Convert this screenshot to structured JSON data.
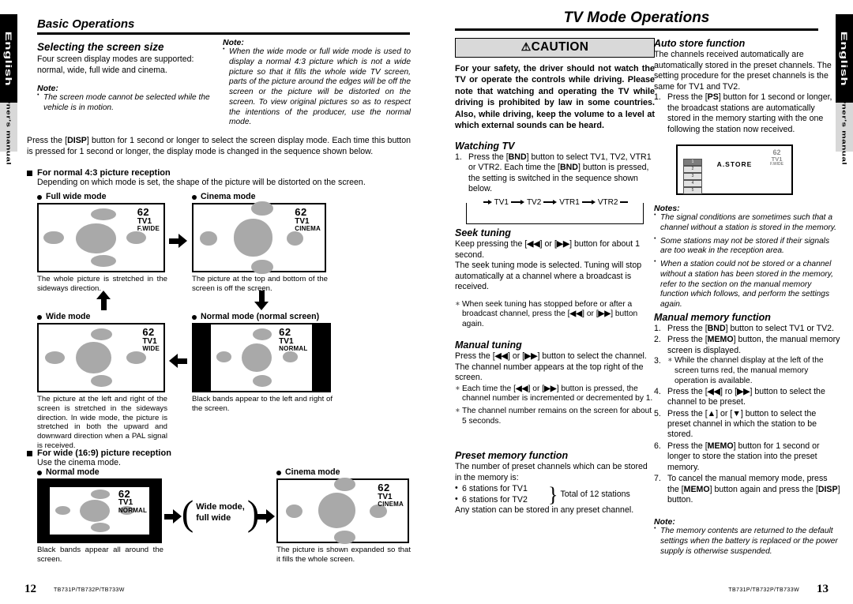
{
  "sidetabs": {
    "language": "English",
    "manual": "Owner's manual"
  },
  "left_page": {
    "chapter_title": "Basic Operations",
    "page_number": "12",
    "model_footer": "TB731P/TB732P/TB733W",
    "section_screen_size": {
      "title": "Selecting the screen size",
      "body": "Four screen display modes are supported: normal, wide, full wide and cinema.",
      "note_label": "Note:",
      "note_items": [
        "The screen mode cannot be selected while the vehicle is in motion."
      ]
    },
    "note_right": {
      "label": "Note:",
      "items": [
        "When the wide mode or full wide mode is used to display a normal 4:3 picture which is not a wide picture so that it fills the whole wide TV screen, parts of the picture around the edges will be off the screen or the picture will be distorted on the screen.  To view original pictures so as to respect the intentions of the producer, use the normal mode."
      ]
    },
    "disp_paragraph": "Press the [DISP] button for 1 second or longer to select the screen display mode. Each time this button is pressed for 1 second or longer, the display mode is changed in the sequence shown below.",
    "disp_button": "DISP",
    "normal43": {
      "heading": "For normal 4:3 picture reception",
      "subtext": "Depending on which mode is set, the shape of the picture will be distorted on the screen."
    },
    "wide169": {
      "heading": "For wide (16:9) picture reception",
      "subtext": "Use the cinema mode."
    },
    "modes": {
      "fullwide": {
        "label": "Full wide mode",
        "osd_channel": "62",
        "osd_band": "TV1",
        "osd_mode": "F.WIDE",
        "caption": "The whole picture is stretched in the sideways direction."
      },
      "cinema": {
        "label": "Cinema mode",
        "osd_channel": "62",
        "osd_band": "TV1",
        "osd_mode": "CINEMA",
        "caption": "The picture at the top and bottom of the screen is off the screen."
      },
      "wide": {
        "label": "Wide mode",
        "osd_channel": "62",
        "osd_band": "TV1",
        "osd_mode": "WIDE",
        "caption": "The picture at the left and right of the screen is stretched in the sideways direction. In wide mode, the picture is stretched in both the upward and downward direction when a PAL signal is received."
      },
      "normal": {
        "label": "Normal mode (normal screen)",
        "osd_channel": "62",
        "osd_band": "TV1",
        "osd_mode": "NORMAL",
        "caption": "Black bands appear to the left and right of the screen."
      },
      "normal169": {
        "label": "Normal mode",
        "osd_channel": "62",
        "osd_band": "TV1",
        "osd_mode": "NORMAL",
        "caption": "Black bands appear all around the screen."
      },
      "cinema169": {
        "label": "Cinema mode",
        "osd_channel": "62",
        "osd_band": "TV1",
        "osd_mode": "CINEMA",
        "caption": "The picture is shown expanded so that it fills the whole screen."
      }
    },
    "transition_label": "Wide mode,\nfull wide"
  },
  "right_page": {
    "chapter_title": "TV Mode Operations",
    "page_number": "13",
    "model_footer": "TB731P/TB732P/TB733W",
    "caution": {
      "title": "CAUTION",
      "symbol": "⚠",
      "body": "For your safety, the driver should not watch the TV or operate the controls while driving. Please note that watching and operating the TV while driving is prohibited by law in some countries. Also, while driving, keep the volume to a level at which external sounds can be heard."
    },
    "watching_tv": {
      "title": "Watching TV",
      "steps": [
        "Press the [BND] button to select TV1, TV2, VTR1 or VTR2. Each time the [BND] button is pressed, the setting is switched in the sequence shown below."
      ],
      "sequence": [
        "TV1",
        "TV2",
        "VTR1",
        "VTR2"
      ]
    },
    "seek_tuning": {
      "title": "Seek tuning",
      "body": "Keep pressing the [◀◀] or [▶▶] button for about 1 second.\nThe seek tuning mode is selected.  Tuning will stop automatically at a channel where a broadcast is received.",
      "notes": [
        "When seek tuning has stopped before or after a broadcast channel, press the [◀◀] or [▶▶] button again."
      ]
    },
    "manual_tuning": {
      "title": "Manual tuning",
      "body": "Press the [◀◀] or [▶▶] button to select the channel.\nThe channel number appears at the top right of the screen.",
      "notes": [
        "Each time the [◀◀] or [▶▶] button is pressed, the channel number is incremented or decremented by 1.",
        "The channel number remains on the screen for about 5 seconds."
      ]
    },
    "preset_memory": {
      "title": "Preset memory function",
      "body": "The number of preset channels which can be stored in the memory is:",
      "items": [
        "6 stations for TV1",
        "6 stations for TV2"
      ],
      "total": "Total of 12 stations",
      "footer": "Any station can be stored in any preset channel."
    },
    "auto_store": {
      "title": "Auto store function",
      "body": "The channels received automatically are automatically stored in the preset channels. The setting procedure for the preset channels is the same for TV1 and TV2.",
      "steps": [
        "Press the [PS] button for 1 second or longer, the broadcast stations are automatically stored in the memory starting with the one following the station now received."
      ],
      "screen": {
        "osd_channel": "62",
        "osd_band": "TV1",
        "osd_mode": "F.WIDE",
        "label": "A.STORE",
        "presets": [
          "1",
          "2",
          "3",
          "4",
          "5",
          "6"
        ]
      },
      "notes_label": "Notes:",
      "notes": [
        "The signal conditions are sometimes such that a channel without a station is stored in the memory.",
        "Some stations may not be stored if their signals are too weak in the reception area.",
        "When a station could not be stored or a channel without a station has been stored in the memory, refer to the section on the manual memory function which follows, and perform the settings again."
      ]
    },
    "manual_memory": {
      "title": "Manual memory function",
      "steps": [
        "Press the [BND] button to select TV1 or TV2.",
        "Press the [MEMO] button, the manual memory screen is displayed.",
        "Press the [◀◀] ro [▶▶] button to select the channel to be preset.",
        "Press the [▲] or [▼] button to select the preset channel in which the station to be stored.",
        "Press the [MEMO] button for 1 second or longer to store the station into the preset memory.",
        "To cancel the manual memory mode, press the [MEMO] button again and press the [DISP] button."
      ],
      "step2_note": "While the channel display at the left of the screen turns red, the manual memory operation is available.",
      "note_label": "Note:",
      "notes": [
        "The memory contents are returned to the default settings when the battery is replaced or the power supply is otherwise suspended."
      ]
    }
  },
  "colors": {
    "blob": "#a9a9a9",
    "caution_bg": "#d9d9d9",
    "tab_black": "#000000",
    "tab_gray": "#d8d8d8"
  }
}
